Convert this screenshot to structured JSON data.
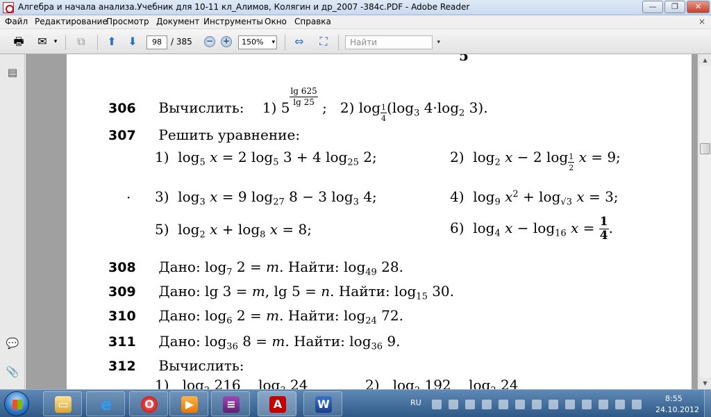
{
  "window": {
    "title": "Алгебра и начала анализа.Учебник для 10-11 кл_Алимов, Колягин и др_2007 -384с.PDF - Adobe Reader",
    "min_symbol": "—",
    "max_symbol": "❐",
    "close_symbol": "✕"
  },
  "menu": {
    "items": [
      "Файл",
      "Редактирование",
      "Просмотр",
      "Документ",
      "Инструменты",
      "Окно",
      "Справка"
    ],
    "close_symbol": "×"
  },
  "toolbar": {
    "page_number": "98",
    "page_total": "/ 385",
    "zoom": "150%",
    "search_placeholder": "Найти",
    "icons": [
      "print-icon",
      "email-icon",
      "collaborate-icon",
      "previous-page-icon",
      "next-page-icon",
      "zoom-out-icon",
      "zoom-in-icon",
      "fit-width-icon",
      "fit-page-icon"
    ]
  },
  "navpane": {
    "icons": [
      "pages-icon",
      "comments-icon",
      "attachments-icon"
    ]
  },
  "document": {
    "top_fragment": "5",
    "dot_marker": "·",
    "problems": [
      {
        "number": "306",
        "label": "Вычислить:"
      },
      {
        "number": "307",
        "label": "Решить уравнение:"
      },
      {
        "number": "308",
        "text_given": "Дано:",
        "text_find": "Найти:"
      },
      {
        "number": "309",
        "text_given": "Дано:",
        "text_find": "Найти:"
      },
      {
        "number": "310",
        "text_given": "Дано:",
        "text_find": "Найти:"
      },
      {
        "number": "311",
        "text_given": "Дано:",
        "text_find": "Найти:"
      },
      {
        "number": "312",
        "label": "Вычислить:"
      }
    ]
  },
  "taskbar": {
    "language": "RU",
    "time": "8:55",
    "date": "24.10.2012",
    "apps": [
      "explorer",
      "internet-explorer",
      "opera",
      "media-player",
      "winrar",
      "adobe-reader",
      "word"
    ]
  }
}
